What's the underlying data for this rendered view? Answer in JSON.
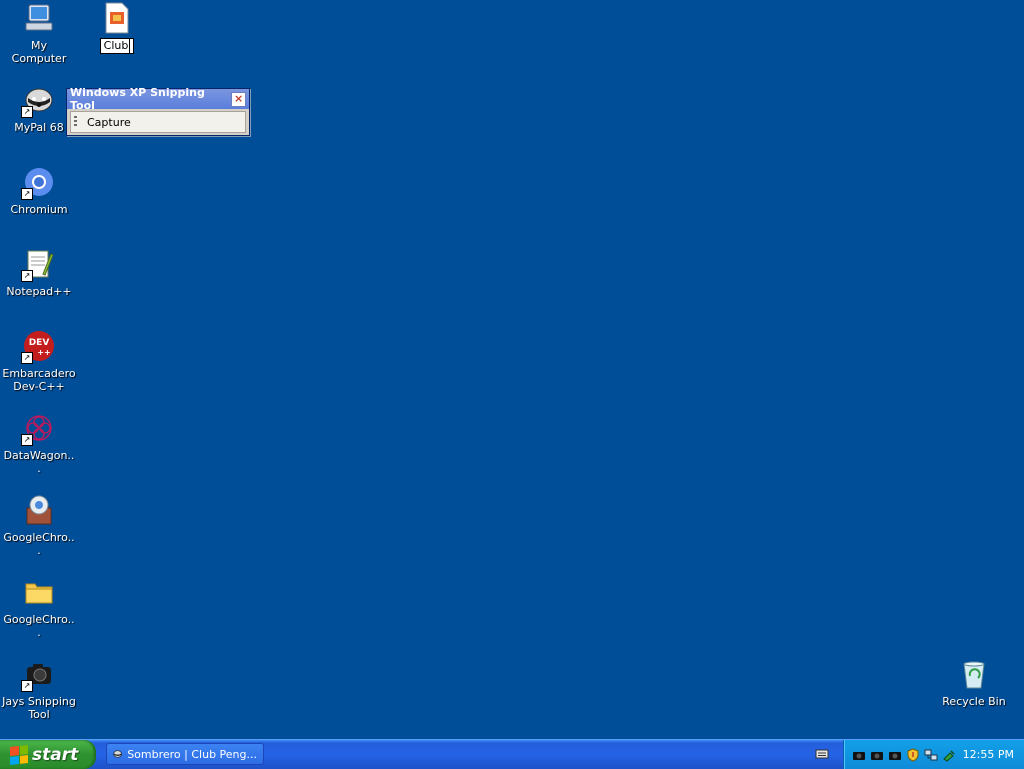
{
  "desktop": {
    "icons": [
      {
        "label": "My Computer",
        "icon": "my-computer-icon"
      },
      {
        "label": "MyPal 68",
        "icon": "mypal-icon"
      },
      {
        "label": "Chromium",
        "icon": "chromium-icon"
      },
      {
        "label": "Notepad++",
        "icon": "notepad-plus-plus-icon"
      },
      {
        "label": "Embarcadero Dev-C++",
        "icon": "devcpp-icon",
        "icon_text": "DEV"
      },
      {
        "label": "DataWagon...",
        "icon": "datawagon-icon"
      },
      {
        "label": "GoogleChro...",
        "icon": "google-chrome-portable-icon"
      },
      {
        "label": "GoogleChro...",
        "icon": "folder-icon"
      },
      {
        "label": "Jays Snipping Tool",
        "icon": "camera-icon"
      },
      {
        "label": "Recycle Bin",
        "icon": "recycle-bin-icon"
      }
    ],
    "renaming_icon": {
      "value": "Club",
      "icon": "document-icon"
    }
  },
  "snipping_tool": {
    "title": "Windows XP Snipping Tool",
    "capture_label": "Capture"
  },
  "taskbar": {
    "start_label": "start",
    "task_button_label": "Sombrero | Club Peng...",
    "clock": "12:55 PM"
  },
  "colors": {
    "desktop": "#004e98",
    "taskbar": "#245edb",
    "start": "#2f9230",
    "tray": "#0f8bd8"
  }
}
